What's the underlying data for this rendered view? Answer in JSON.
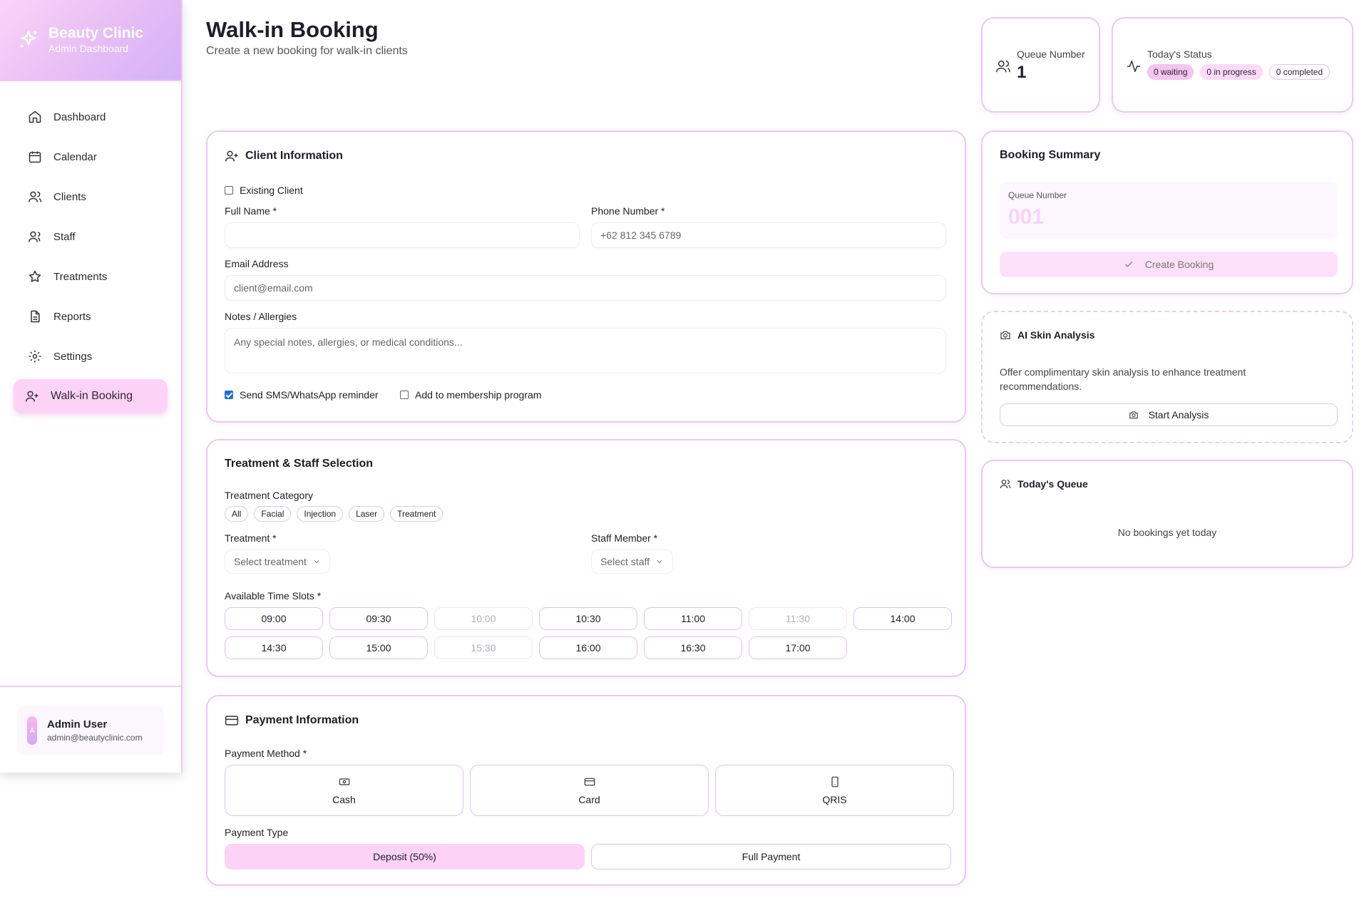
{
  "brand": {
    "title": "Beauty Clinic",
    "subtitle": "Admin Dashboard"
  },
  "nav": {
    "items": [
      {
        "label": "Dashboard",
        "icon": "home-icon"
      },
      {
        "label": "Calendar",
        "icon": "calendar-icon"
      },
      {
        "label": "Clients",
        "icon": "users-icon"
      },
      {
        "label": "Staff",
        "icon": "user-group-icon"
      },
      {
        "label": "Treatments",
        "icon": "star-icon"
      },
      {
        "label": "Reports",
        "icon": "file-icon"
      },
      {
        "label": "Settings",
        "icon": "gear-icon"
      },
      {
        "label": "Walk-in Booking",
        "icon": "user-plus-icon",
        "active": true
      }
    ]
  },
  "user": {
    "initial": "A",
    "name": "Admin User",
    "email": "admin@beautyclinic.com"
  },
  "header": {
    "title": "Walk-in Booking",
    "subtitle": "Create a new booking for walk-in clients"
  },
  "queue_stat": {
    "label": "Queue Number",
    "value": "1"
  },
  "status_stat": {
    "label": "Today's Status",
    "waiting": "0 waiting",
    "in_progress": "0 in progress",
    "completed": "0 completed"
  },
  "client": {
    "title": "Client Information",
    "existing_label": "Existing Client",
    "existing_checked": false,
    "full_name_label": "Full Name *",
    "full_name_value": "",
    "phone_label": "Phone Number *",
    "phone_placeholder": "+62 812 345 6789",
    "email_label": "Email Address",
    "email_placeholder": "client@email.com",
    "notes_label": "Notes / Allergies",
    "notes_placeholder": "Any special notes, allergies, or medical conditions...",
    "reminder_label": "Send SMS/WhatsApp reminder",
    "reminder_checked": true,
    "membership_label": "Add to membership program",
    "membership_checked": false
  },
  "treatment": {
    "title": "Treatment & Staff Selection",
    "category_label": "Treatment Category",
    "categories": [
      "All",
      "Facial",
      "Injection",
      "Laser",
      "Treatment"
    ],
    "treatment_label": "Treatment *",
    "treatment_value": "Select treatment",
    "staff_label": "Staff Member *",
    "staff_value": "Select staff",
    "slots_label": "Available Time Slots *",
    "slots": [
      {
        "time": "09:00",
        "available": true
      },
      {
        "time": "09:30",
        "available": true
      },
      {
        "time": "10:00",
        "available": false
      },
      {
        "time": "10:30",
        "available": true
      },
      {
        "time": "11:00",
        "available": true
      },
      {
        "time": "11:30",
        "available": false
      },
      {
        "time": "14:00",
        "available": true
      },
      {
        "time": "14:30",
        "available": true
      },
      {
        "time": "15:00",
        "available": true
      },
      {
        "time": "15:30",
        "available": false
      },
      {
        "time": "16:00",
        "available": true
      },
      {
        "time": "16:30",
        "available": true
      },
      {
        "time": "17:00",
        "available": true
      }
    ]
  },
  "payment": {
    "title": "Payment Information",
    "method_label": "Payment Method *",
    "methods": [
      {
        "label": "Cash",
        "icon": "cash-icon"
      },
      {
        "label": "Card",
        "icon": "card-icon"
      },
      {
        "label": "QRIS",
        "icon": "phone-icon"
      }
    ],
    "type_label": "Payment Type",
    "types": [
      {
        "label": "Deposit (50%)",
        "active": true
      },
      {
        "label": "Full Payment",
        "active": false
      }
    ]
  },
  "summary": {
    "title": "Booking Summary",
    "queue_label": "Queue Number",
    "queue_value": "001",
    "create_label": "Create Booking"
  },
  "ai": {
    "title": "AI Skin Analysis",
    "text": "Offer complimentary skin analysis to enhance treatment recommendations.",
    "button": "Start Analysis"
  },
  "today_queue": {
    "title": "Today's Queue",
    "empty": "No bookings yet today"
  },
  "colors": {
    "accent": "#fcd3f7",
    "brand_gradient_start": "#fbd3f7",
    "brand_gradient_end": "#d3b2f8",
    "border": "#ecc8ee"
  }
}
